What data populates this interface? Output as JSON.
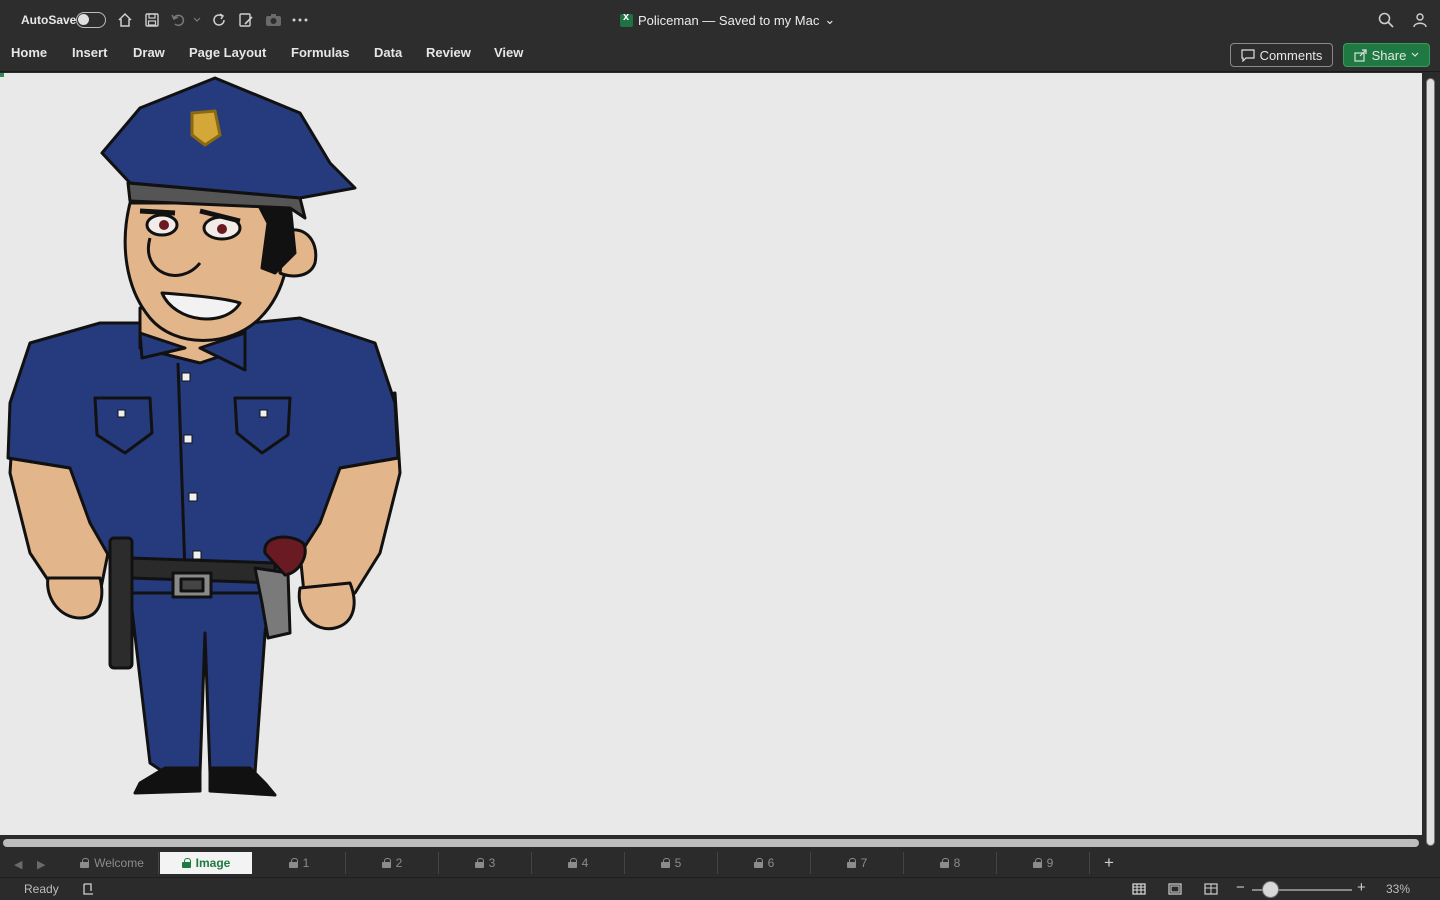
{
  "titlebar": {
    "autosave_label": "AutoSave",
    "document_title": "Policeman — Saved to my Mac",
    "title_chevron": "⌄"
  },
  "ribbon": {
    "tabs": [
      "Home",
      "Insert",
      "Draw",
      "Page Layout",
      "Formulas",
      "Data",
      "Review",
      "View"
    ],
    "comments_label": "Comments",
    "share_label": "Share"
  },
  "sheet_tabs": {
    "items": [
      "Welcome",
      "Image",
      "1",
      "2",
      "3",
      "4",
      "5",
      "6",
      "7",
      "8",
      "9"
    ],
    "active": "Image",
    "add_label": "+"
  },
  "status": {
    "ready": "Ready",
    "zoom": "33%"
  },
  "colors": {
    "accent": "#1e7a42",
    "uniform": "#263a7e",
    "skin": "#e3b58a"
  }
}
